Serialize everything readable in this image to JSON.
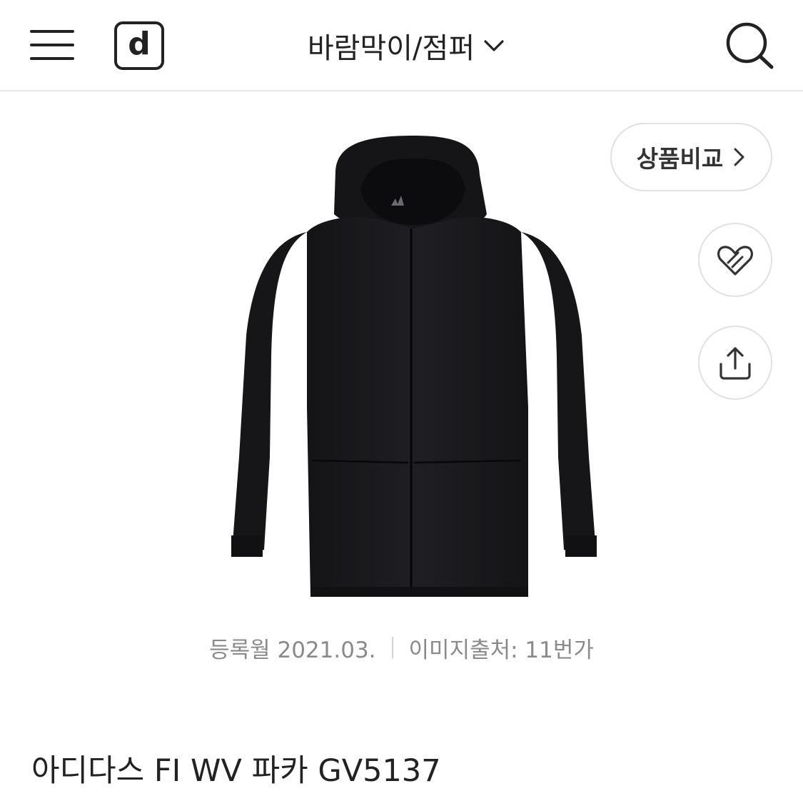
{
  "header": {
    "logo_text": "d",
    "category_title": "바람막이/점퍼",
    "menu_icon": "hamburger-menu-icon",
    "dropdown_icon": "chevron-down-icon",
    "search_icon": "search-icon"
  },
  "side_actions": {
    "compare_label": "상품비교",
    "compare_icon": "chevron-right-icon",
    "wishlist_icon": "heart-outline-icon",
    "share_icon": "share-upload-icon"
  },
  "product": {
    "image_icon": "jacket-image",
    "registered": "등록월 2021.03.",
    "image_source": "이미지출처: 11번가",
    "title": "아디다스 FI WV 파카 GV5137"
  },
  "colors": {
    "text": "#222222",
    "muted": "#8a8a8a",
    "border": "#e1e1e1",
    "jacket": "#18181b"
  }
}
